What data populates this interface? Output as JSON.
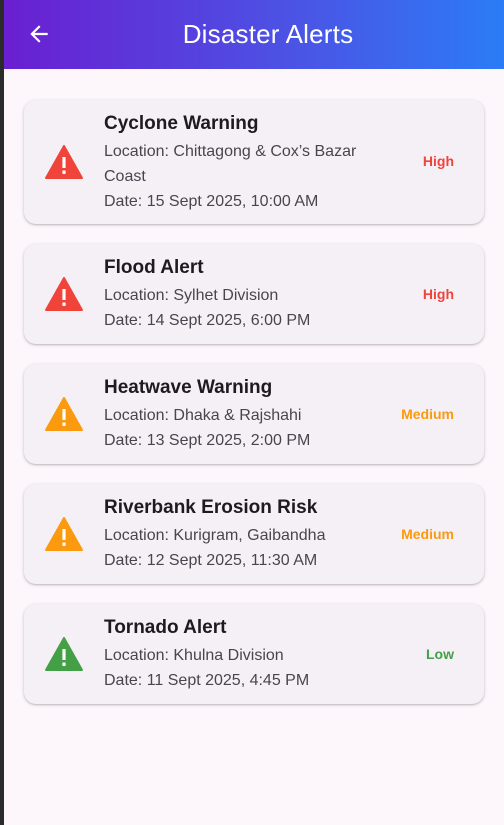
{
  "app_bar": {
    "title": "Disaster Alerts",
    "back_icon": "arrow-left-icon"
  },
  "colors": {
    "high": "#f0443a",
    "medium": "#fb9a0e",
    "low": "#43a047"
  },
  "alerts": [
    {
      "title": "Cyclone Warning",
      "location": "Location: Chittagong & Cox’s Bazar",
      "location_cont": "Coast",
      "date": "Date: 15 Sept 2025, 10:00 AM",
      "severity": "High",
      "icon": "warning-triangle-icon"
    },
    {
      "title": "Flood Alert",
      "location": "Location: Sylhet Division",
      "date": "Date: 14 Sept 2025, 6:00 PM",
      "severity": "High",
      "icon": "warning-triangle-icon"
    },
    {
      "title": "Heatwave Warning",
      "location": "Location: Dhaka & Rajshahi",
      "date": "Date: 13 Sept 2025, 2:00 PM",
      "severity": "Medium",
      "icon": "warning-triangle-icon"
    },
    {
      "title": "Riverbank Erosion Risk",
      "location": "Location: Kurigram, Gaibandha",
      "date": "Date: 12 Sept 2025, 11:30 AM",
      "severity": "Medium",
      "icon": "warning-triangle-icon"
    },
    {
      "title": "Tornado Alert",
      "location": "Location: Khulna Division",
      "date": "Date: 11 Sept 2025, 4:45 PM",
      "severity": "Low",
      "icon": "warning-triangle-icon"
    }
  ]
}
